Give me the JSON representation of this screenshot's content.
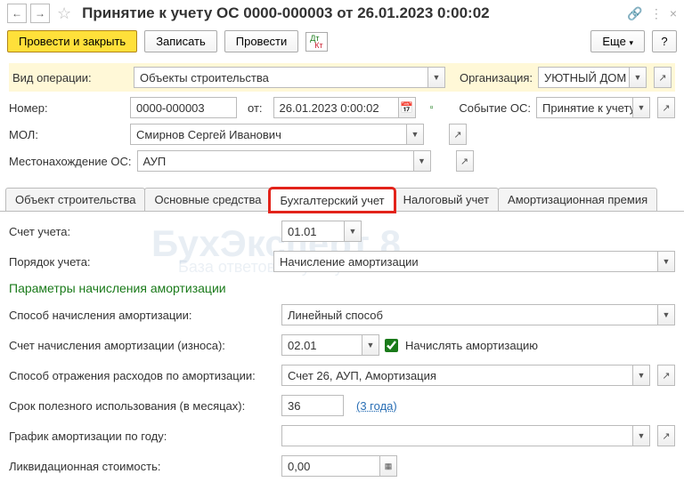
{
  "header": {
    "title": "Принятие к учету ОС 0000-000003 от 26.01.2023 0:00:02"
  },
  "toolbar": {
    "post_close": "Провести и закрыть",
    "write": "Записать",
    "post": "Провести",
    "more": "Еще",
    "help": "?"
  },
  "form": {
    "op_type_label": "Вид операции:",
    "op_type": "Объекты строительства",
    "org_label": "Организация:",
    "org": "УЮТНЫЙ ДОМ ОС",
    "number_label": "Номер:",
    "number": "0000-000003",
    "from_label": "от:",
    "date": "26.01.2023  0:00:02",
    "event_label": "Событие ОС:",
    "event": "Принятие к учету",
    "mol_label": "МОЛ:",
    "mol": "Смирнов Сергей Иванович",
    "loc_label": "Местонахождение ОС:",
    "loc": "АУП"
  },
  "tabs": {
    "t1": "Объект строительства",
    "t2": "Основные средства",
    "t3": "Бухгалтерский учет",
    "t4": "Налоговый учет",
    "t5": "Амортизационная премия"
  },
  "acc": {
    "account_label": "Счет учета:",
    "account": "01.01",
    "order_label": "Порядок учета:",
    "order": "Начисление амортизации",
    "params_heading": "Параметры начисления амортизации",
    "method_label": "Способ начисления амортизации:",
    "method": "Линейный способ",
    "dep_account_label": "Счет начисления амортизации (износа):",
    "dep_account": "02.01",
    "dep_flag_label": "Начислять амортизацию",
    "expense_label": "Способ отражения расходов по амортизации:",
    "expense": "Счет 26, АУП, Амортизация",
    "life_label": "Срок полезного использования (в месяцах):",
    "life": "36",
    "life_hint": "(3 года)",
    "schedule_label": "График амортизации по году:",
    "salvage_label": "Ликвидационная стоимость:",
    "salvage": "0,00"
  }
}
